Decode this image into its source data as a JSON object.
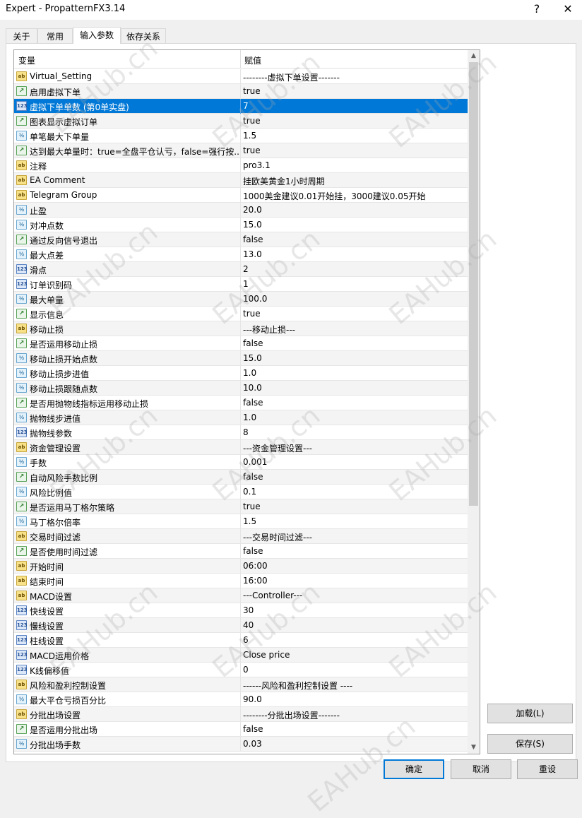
{
  "window": {
    "title": "Expert - PropatternFX3.14",
    "help_label": "?",
    "close_label": "✕"
  },
  "tabs": [
    "关于",
    "常用",
    "输入参数",
    "依存关系"
  ],
  "grid": {
    "col_variable": "变量",
    "col_value": "赋值",
    "rows": [
      {
        "type": "ab",
        "name": "Virtual_Setting",
        "value": "--------虚拟下单设置-------"
      },
      {
        "type": "bool",
        "name": "启用虚拟下单",
        "value": "true"
      },
      {
        "type": "int",
        "name": "虚拟下单单数 (第0单实盘)",
        "value": "7",
        "selected": true
      },
      {
        "type": "bool",
        "name": "图表显示虚拟订单",
        "value": "true"
      },
      {
        "type": "dbl",
        "name": "单笔最大下单量",
        "value": "1.5"
      },
      {
        "type": "bool",
        "name": "达到最大单量时：true=全盘平仓认亏，false=强行按...",
        "value": "true"
      },
      {
        "type": "ab",
        "name": "注释",
        "value": "pro3.1"
      },
      {
        "type": "ab",
        "name": "EA Comment",
        "value": "挂欧美黄金1小时周期"
      },
      {
        "type": "ab",
        "name": "Telegram Group",
        "value": "1000美金建议0.01开始挂，3000建议0.05开始"
      },
      {
        "type": "dbl",
        "name": "止盈",
        "value": "20.0"
      },
      {
        "type": "dbl",
        "name": "对冲点数",
        "value": "15.0"
      },
      {
        "type": "bool",
        "name": "通过反向信号退出",
        "value": "false"
      },
      {
        "type": "dbl",
        "name": "最大点差",
        "value": "13.0"
      },
      {
        "type": "int",
        "name": "滑点",
        "value": "2"
      },
      {
        "type": "int",
        "name": "订单识别码",
        "value": "1"
      },
      {
        "type": "dbl",
        "name": "最大单量",
        "value": "100.0"
      },
      {
        "type": "bool",
        "name": "显示信息",
        "value": "true"
      },
      {
        "type": "ab",
        "name": "移动止损",
        "value": "---移动止损---"
      },
      {
        "type": "bool",
        "name": "是否运用移动止损",
        "value": "false"
      },
      {
        "type": "dbl",
        "name": "移动止损开始点数",
        "value": "15.0"
      },
      {
        "type": "dbl",
        "name": "移动止损步进值",
        "value": "1.0"
      },
      {
        "type": "dbl",
        "name": "移动止损跟随点数",
        "value": "10.0"
      },
      {
        "type": "bool",
        "name": "是否用抛物线指标运用移动止损",
        "value": "false"
      },
      {
        "type": "dbl",
        "name": "抛物线步进值",
        "value": "1.0"
      },
      {
        "type": "int",
        "name": "抛物线参数",
        "value": "8"
      },
      {
        "type": "ab",
        "name": "资金管理设置",
        "value": "---资金管理设置---"
      },
      {
        "type": "dbl",
        "name": "手数",
        "value": "0.001"
      },
      {
        "type": "bool",
        "name": "自动风险手数比例",
        "value": "false"
      },
      {
        "type": "dbl",
        "name": "风险比例值",
        "value": "0.1"
      },
      {
        "type": "bool",
        "name": "是否运用马丁格尔策略",
        "value": "true"
      },
      {
        "type": "dbl",
        "name": "马丁格尔倍率",
        "value": "1.5"
      },
      {
        "type": "ab",
        "name": "交易时间过滤",
        "value": "---交易时间过滤---"
      },
      {
        "type": "bool",
        "name": "是否使用时间过滤",
        "value": "false"
      },
      {
        "type": "ab",
        "name": "开始时间",
        "value": "06:00"
      },
      {
        "type": "ab",
        "name": "结束时间",
        "value": "16:00"
      },
      {
        "type": "ab",
        "name": "MACD设置",
        "value": "---Controller---"
      },
      {
        "type": "int",
        "name": "快线设置",
        "value": "30"
      },
      {
        "type": "int",
        "name": "慢线设置",
        "value": "40"
      },
      {
        "type": "int",
        "name": "柱线设置",
        "value": "6"
      },
      {
        "type": "int",
        "name": "MACD运用价格",
        "value": "Close price"
      },
      {
        "type": "int",
        "name": "K线偏移值",
        "value": "0"
      },
      {
        "type": "ab",
        "name": "风险和盈利控制设置",
        "value": "------风险和盈利控制设置 ----"
      },
      {
        "type": "dbl",
        "name": "最大平仓亏损百分比",
        "value": "90.0"
      },
      {
        "type": "ab",
        "name": "分批出场设置",
        "value": "--------分批出场设置-------"
      },
      {
        "type": "bool",
        "name": "是否运用分批出场",
        "value": "false"
      },
      {
        "type": "dbl",
        "name": "分批出场手数",
        "value": "0.03"
      }
    ]
  },
  "icon_labels": {
    "ab": "ab",
    "bool": "↗",
    "int": "123",
    "dbl": "½"
  },
  "buttons": {
    "load": "加载(L)",
    "save": "保存(S)",
    "ok": "确定",
    "cancel": "取消",
    "reset": "重设"
  },
  "watermark": "EAHub.cn"
}
